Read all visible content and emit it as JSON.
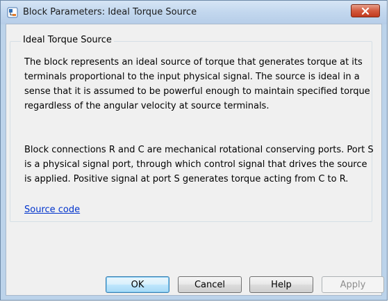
{
  "window": {
    "title": "Block Parameters: Ideal Torque Source"
  },
  "group": {
    "title": "Ideal Torque Source",
    "paragraph1": "The block represents an ideal source of torque that generates torque at its terminals proportional to the input physical signal. The source is ideal in a sense that it is assumed to be powerful enough to maintain specified torque regardless of the angular velocity at source terminals.",
    "paragraph2": "Block connections R and C are mechanical rotational conserving ports. Port S is a physical signal port, through which control signal that drives the source is applied. Positive signal at port S generates torque acting from C to R.",
    "link_text": "Source code"
  },
  "buttons": {
    "ok": "OK",
    "cancel": "Cancel",
    "help": "Help",
    "apply": "Apply"
  },
  "icons": {
    "title_icon": "simulink-block-icon",
    "close_icon": "close-icon"
  },
  "colors": {
    "title_bar": "#c2d7ee",
    "close_button": "#d35a3e",
    "link": "#0033cc",
    "client_bg": "#f0f0f0"
  }
}
